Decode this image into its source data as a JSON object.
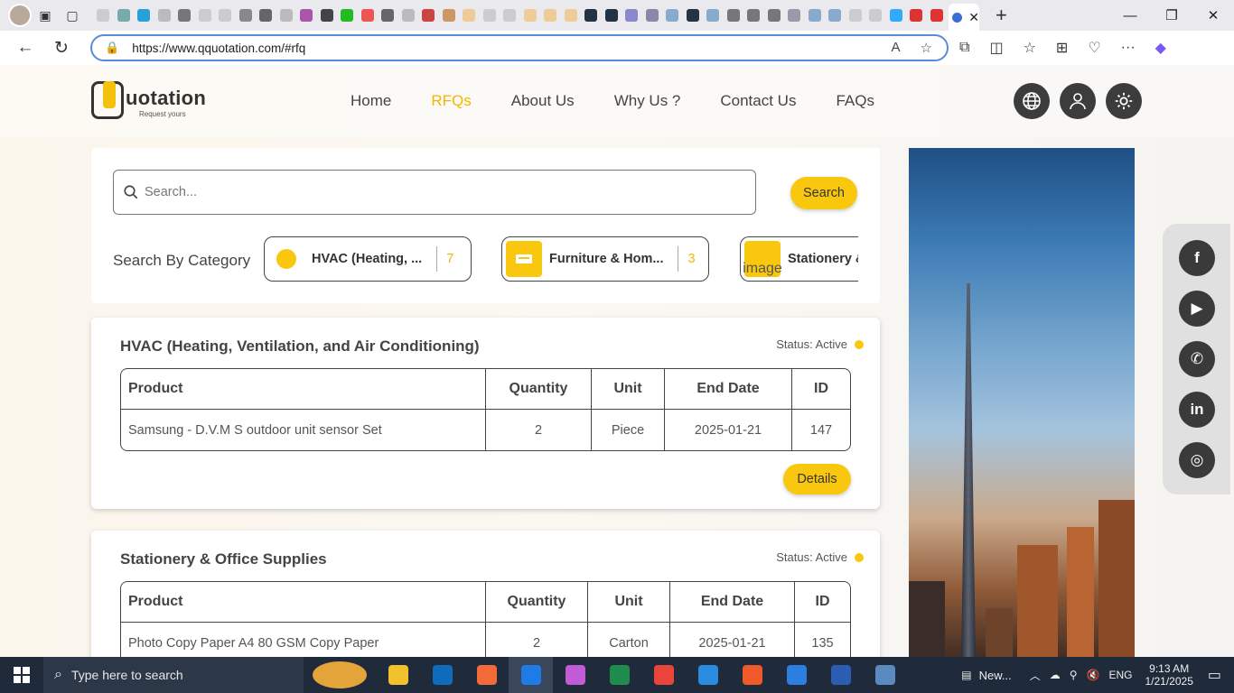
{
  "browser": {
    "url": "https://www.qquotation.com/#rfq",
    "active_tab_close": "✕"
  },
  "site": {
    "brand": "uotation",
    "tagline": "Request yours",
    "nav": [
      "Home",
      "RFQs",
      "About Us",
      "Why Us ?",
      "Contact Us",
      "FAQs"
    ],
    "active_nav": "RFQs",
    "accent": "#f9c80e"
  },
  "search": {
    "placeholder": "Search...",
    "button": "Search",
    "category_label": "Search By Category",
    "categories": [
      {
        "name": "HVAC (Heating, ...",
        "count": "7"
      },
      {
        "name": "Furniture & Hom...",
        "count": "3"
      },
      {
        "name": "Stationery &",
        "image_alt": "image"
      }
    ]
  },
  "rfqs": [
    {
      "title": "HVAC (Heating, Ventilation, and Air Conditioning)",
      "status": "Status: Active",
      "headers": [
        "Product",
        "Quantity",
        "Unit",
        "End Date",
        "ID"
      ],
      "rows": [
        [
          "Samsung - D.V.M S outdoor unit sensor Set",
          "2",
          "Piece",
          "2025-01-21",
          "147"
        ]
      ],
      "details": "Details"
    },
    {
      "title": "Stationery & Office Supplies",
      "status": "Status: Active",
      "headers": [
        "Product",
        "Quantity",
        "Unit",
        "End Date",
        "ID"
      ],
      "rows": [
        [
          "Photo Copy Paper A4 80 GSM Copy Paper",
          "2",
          "Carton",
          "2025-01-21",
          "135"
        ]
      ]
    }
  ],
  "social": [
    "facebook-icon",
    "youtube-icon",
    "whatsapp-icon",
    "linkedin-icon",
    "instagram-icon"
  ],
  "taskbar": {
    "search_text": "Type here to search",
    "news": "New...",
    "lang": "ENG",
    "time": "9:13 AM",
    "date": "1/21/2025"
  }
}
